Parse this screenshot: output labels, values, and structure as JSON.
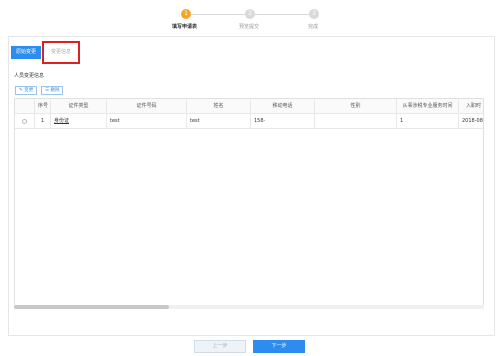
{
  "steps": [
    {
      "number": "1",
      "label": "填写申请表"
    },
    {
      "number": "2",
      "label": "预览提交"
    },
    {
      "number": "3",
      "label": "完成"
    }
  ],
  "tabs": {
    "active": "原始变更",
    "inactive": "变更信息"
  },
  "section_title": "人员变更信息",
  "actions": {
    "edit": "✎ 变更",
    "delete": "☰ 删除"
  },
  "table": {
    "columns": [
      "",
      "序号",
      "证件类型",
      "证件号码",
      "姓名",
      "移动电话",
      "性别",
      "从事涉税专业服务时间",
      "入职时"
    ],
    "rows": [
      [
        "",
        "1",
        "身份证",
        "test",
        "test",
        "158·",
        "",
        "1",
        "2018-08-"
      ]
    ]
  },
  "footer": {
    "prev": "上一步",
    "next": "下一步"
  },
  "colors": {
    "primary": "#2d8cf0",
    "step_active": "#f5a623",
    "highlight": "#e02020"
  }
}
